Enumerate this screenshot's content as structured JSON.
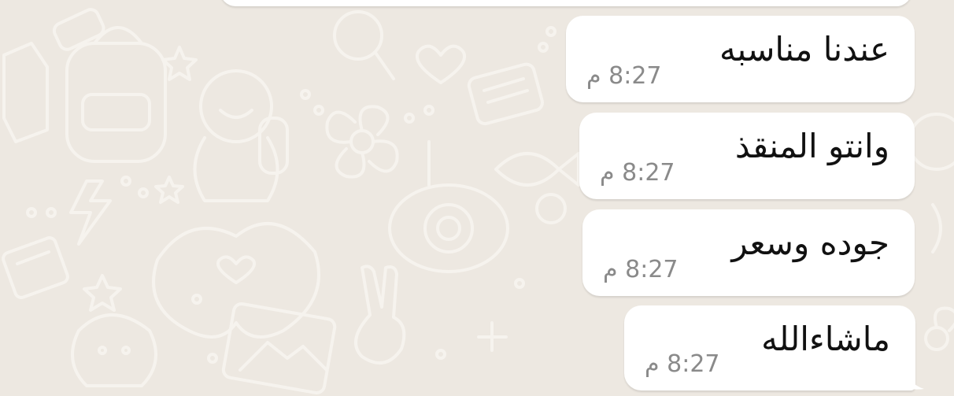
{
  "chat": {
    "messages": [
      {
        "text": "عندنا مناسبه",
        "time": "8:27 م"
      },
      {
        "text": "وانتو المنقذ",
        "time": "8:27 م"
      },
      {
        "text": "جوده وسعر",
        "time": "8:27 م"
      },
      {
        "text": "ماشاءالله",
        "time": "8:27 م"
      }
    ]
  },
  "colors": {
    "wallpaper": "#ede8e1",
    "bubble": "#ffffff",
    "message_text": "#111111",
    "timestamp": "#8a8a8a"
  }
}
